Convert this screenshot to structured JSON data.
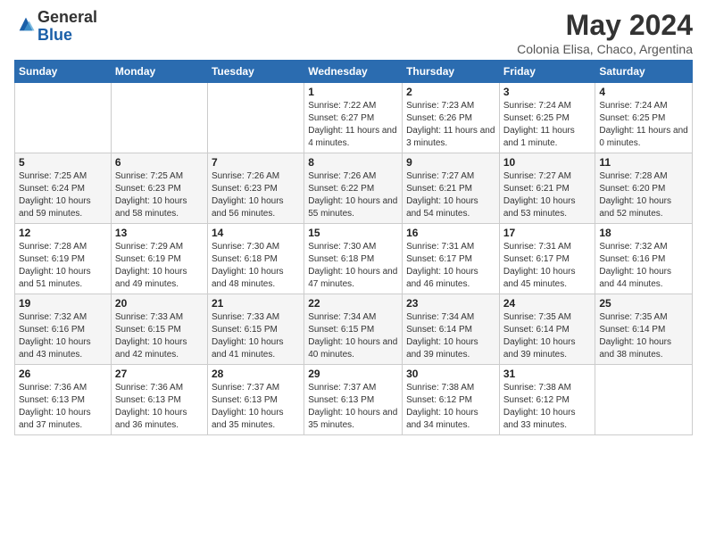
{
  "header": {
    "logo_general": "General",
    "logo_blue": "Blue",
    "month_title": "May 2024",
    "subtitle": "Colonia Elisa, Chaco, Argentina"
  },
  "days_of_week": [
    "Sunday",
    "Monday",
    "Tuesday",
    "Wednesday",
    "Thursday",
    "Friday",
    "Saturday"
  ],
  "weeks": [
    [
      {
        "day": "",
        "info": ""
      },
      {
        "day": "",
        "info": ""
      },
      {
        "day": "",
        "info": ""
      },
      {
        "day": "1",
        "info": "Sunrise: 7:22 AM\nSunset: 6:27 PM\nDaylight: 11 hours\nand 4 minutes."
      },
      {
        "day": "2",
        "info": "Sunrise: 7:23 AM\nSunset: 6:26 PM\nDaylight: 11 hours\nand 3 minutes."
      },
      {
        "day": "3",
        "info": "Sunrise: 7:24 AM\nSunset: 6:25 PM\nDaylight: 11 hours\nand 1 minute."
      },
      {
        "day": "4",
        "info": "Sunrise: 7:24 AM\nSunset: 6:25 PM\nDaylight: 11 hours\nand 0 minutes."
      }
    ],
    [
      {
        "day": "5",
        "info": "Sunrise: 7:25 AM\nSunset: 6:24 PM\nDaylight: 10 hours\nand 59 minutes."
      },
      {
        "day": "6",
        "info": "Sunrise: 7:25 AM\nSunset: 6:23 PM\nDaylight: 10 hours\nand 58 minutes."
      },
      {
        "day": "7",
        "info": "Sunrise: 7:26 AM\nSunset: 6:23 PM\nDaylight: 10 hours\nand 56 minutes."
      },
      {
        "day": "8",
        "info": "Sunrise: 7:26 AM\nSunset: 6:22 PM\nDaylight: 10 hours\nand 55 minutes."
      },
      {
        "day": "9",
        "info": "Sunrise: 7:27 AM\nSunset: 6:21 PM\nDaylight: 10 hours\nand 54 minutes."
      },
      {
        "day": "10",
        "info": "Sunrise: 7:27 AM\nSunset: 6:21 PM\nDaylight: 10 hours\nand 53 minutes."
      },
      {
        "day": "11",
        "info": "Sunrise: 7:28 AM\nSunset: 6:20 PM\nDaylight: 10 hours\nand 52 minutes."
      }
    ],
    [
      {
        "day": "12",
        "info": "Sunrise: 7:28 AM\nSunset: 6:19 PM\nDaylight: 10 hours\nand 51 minutes."
      },
      {
        "day": "13",
        "info": "Sunrise: 7:29 AM\nSunset: 6:19 PM\nDaylight: 10 hours\nand 49 minutes."
      },
      {
        "day": "14",
        "info": "Sunrise: 7:30 AM\nSunset: 6:18 PM\nDaylight: 10 hours\nand 48 minutes."
      },
      {
        "day": "15",
        "info": "Sunrise: 7:30 AM\nSunset: 6:18 PM\nDaylight: 10 hours\nand 47 minutes."
      },
      {
        "day": "16",
        "info": "Sunrise: 7:31 AM\nSunset: 6:17 PM\nDaylight: 10 hours\nand 46 minutes."
      },
      {
        "day": "17",
        "info": "Sunrise: 7:31 AM\nSunset: 6:17 PM\nDaylight: 10 hours\nand 45 minutes."
      },
      {
        "day": "18",
        "info": "Sunrise: 7:32 AM\nSunset: 6:16 PM\nDaylight: 10 hours\nand 44 minutes."
      }
    ],
    [
      {
        "day": "19",
        "info": "Sunrise: 7:32 AM\nSunset: 6:16 PM\nDaylight: 10 hours\nand 43 minutes."
      },
      {
        "day": "20",
        "info": "Sunrise: 7:33 AM\nSunset: 6:15 PM\nDaylight: 10 hours\nand 42 minutes."
      },
      {
        "day": "21",
        "info": "Sunrise: 7:33 AM\nSunset: 6:15 PM\nDaylight: 10 hours\nand 41 minutes."
      },
      {
        "day": "22",
        "info": "Sunrise: 7:34 AM\nSunset: 6:15 PM\nDaylight: 10 hours\nand 40 minutes."
      },
      {
        "day": "23",
        "info": "Sunrise: 7:34 AM\nSunset: 6:14 PM\nDaylight: 10 hours\nand 39 minutes."
      },
      {
        "day": "24",
        "info": "Sunrise: 7:35 AM\nSunset: 6:14 PM\nDaylight: 10 hours\nand 39 minutes."
      },
      {
        "day": "25",
        "info": "Sunrise: 7:35 AM\nSunset: 6:14 PM\nDaylight: 10 hours\nand 38 minutes."
      }
    ],
    [
      {
        "day": "26",
        "info": "Sunrise: 7:36 AM\nSunset: 6:13 PM\nDaylight: 10 hours\nand 37 minutes."
      },
      {
        "day": "27",
        "info": "Sunrise: 7:36 AM\nSunset: 6:13 PM\nDaylight: 10 hours\nand 36 minutes."
      },
      {
        "day": "28",
        "info": "Sunrise: 7:37 AM\nSunset: 6:13 PM\nDaylight: 10 hours\nand 35 minutes."
      },
      {
        "day": "29",
        "info": "Sunrise: 7:37 AM\nSunset: 6:13 PM\nDaylight: 10 hours\nand 35 minutes."
      },
      {
        "day": "30",
        "info": "Sunrise: 7:38 AM\nSunset: 6:12 PM\nDaylight: 10 hours\nand 34 minutes."
      },
      {
        "day": "31",
        "info": "Sunrise: 7:38 AM\nSunset: 6:12 PM\nDaylight: 10 hours\nand 33 minutes."
      },
      {
        "day": "",
        "info": ""
      }
    ]
  ]
}
